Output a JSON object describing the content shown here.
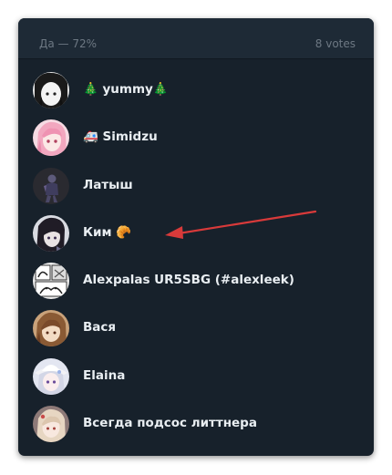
{
  "poll": {
    "option_label": "Да — 72%",
    "votes_label": "8 votes"
  },
  "voters": [
    {
      "name": "🎄 yummy🎄",
      "avatar": "avatar-bw-anime"
    },
    {
      "name": "🚑 Simidzu",
      "avatar": "avatar-pink-hair"
    },
    {
      "name": "Латыш",
      "avatar": "avatar-dark-figure"
    },
    {
      "name": "Ким 🥐",
      "avatar": "avatar-dark-anime"
    },
    {
      "name": "Alexpalas UR5SBG (#alexleek)",
      "avatar": "avatar-manga-panel"
    },
    {
      "name": "Вася",
      "avatar": "avatar-brown-hair"
    },
    {
      "name": "Elaina",
      "avatar": "avatar-silver-hair-hat"
    },
    {
      "name": "Всегда подсос литтнера",
      "avatar": "avatar-light-hair"
    }
  ],
  "annotation": {
    "type": "arrow",
    "color": "#d83a3a"
  },
  "colors": {
    "panel_bg": "#17212b",
    "header_bg": "#1e2a36",
    "name_text": "#e9eef2",
    "muted_text": "#6d7883"
  }
}
